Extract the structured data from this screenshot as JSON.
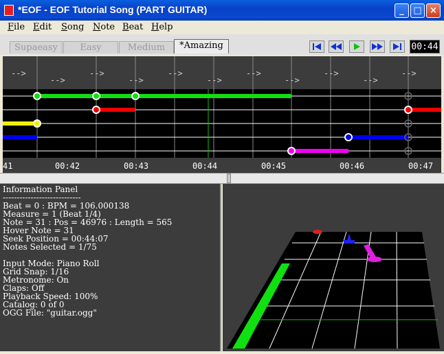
{
  "window": {
    "title": "*EOF - EOF Tutorial Song (PART GUITAR)",
    "minimize": "_",
    "maximize": "□",
    "close": "×"
  },
  "menu": [
    "File",
    "Edit",
    "Song",
    "Note",
    "Beat",
    "Help"
  ],
  "difficulties": [
    "Supaeasy",
    "Easy",
    "Medium",
    "*Amazing"
  ],
  "active_difficulty": "*Amazing",
  "playback": {
    "buttons": [
      "rewind-to-start",
      "rewind",
      "play",
      "fast-forward",
      "seek-end"
    ],
    "time": "00:44"
  },
  "timeline": {
    "beat_marker": "-->",
    "time_labels": [
      "41",
      "00:42",
      "00:43",
      "00:44",
      "00:45",
      "00:46",
      "00:47"
    ]
  },
  "info_panel": {
    "lines": [
      "Information Panel",
      "----------------------------",
      "Beat = 0 : BPM = 106.000138",
      "Measure = 1 (Beat 1/4)",
      "Note = 31 : Pos = 46976 : Length = 565",
      "Hover Note = 31",
      "Seek Position = 00:44:07",
      "Notes Selected = 1/75",
      "",
      "Input Mode: Piano Roll",
      "Grid Snap: 1/16",
      "Metronome: On",
      "Claps: Off",
      "Playback Speed: 100%",
      "Catalog: 0 of 0",
      "OGG File: \"guitar.ogg\""
    ]
  },
  "colors": {
    "green": "#10e010",
    "red": "#f00000",
    "yellow": "#f0f000",
    "blue": "#0000f0",
    "purple": "#f000f0",
    "titlebar": "#0842c8"
  }
}
